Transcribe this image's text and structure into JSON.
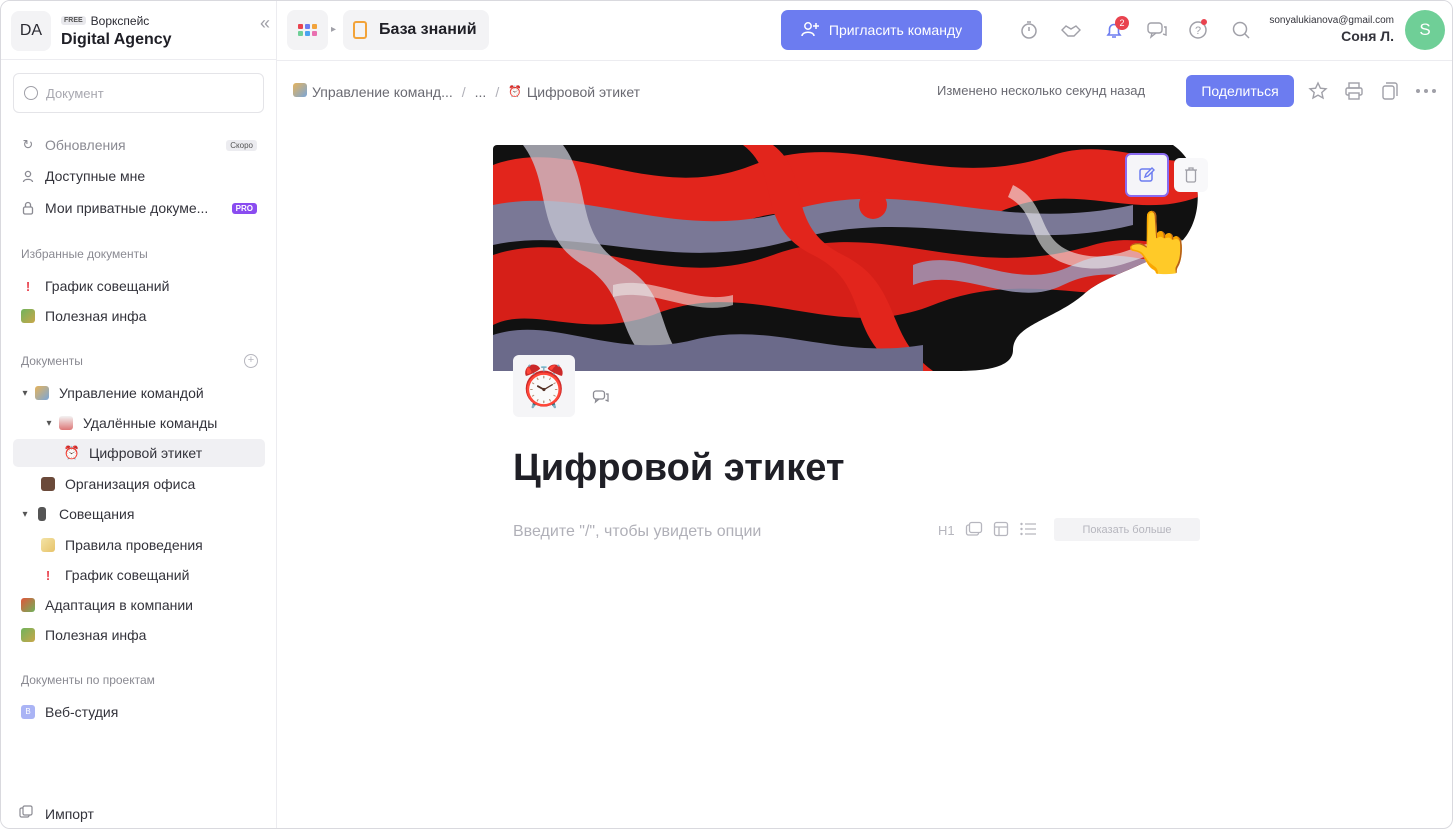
{
  "workspace": {
    "initials": "DA",
    "plan_badge": "FREE",
    "label": "Воркспейс",
    "name": "Digital Agency"
  },
  "search": {
    "placeholder": "Документ"
  },
  "nav": {
    "updates": {
      "label": "Обновления",
      "badge": "Скоро"
    },
    "shared": {
      "label": "Доступные мне"
    },
    "private": {
      "label": "Мои приватные докуме...",
      "badge": "PRO"
    }
  },
  "favorites": {
    "title": "Избранные документы",
    "items": [
      {
        "label": "График совещаний"
      },
      {
        "label": "Полезная инфа"
      }
    ]
  },
  "documents": {
    "title": "Документы",
    "tree": [
      {
        "label": "Управление командой"
      },
      {
        "label": "Удалённые команды"
      },
      {
        "label": "Цифровой этикет"
      },
      {
        "label": "Организация офиса"
      },
      {
        "label": "Совещания"
      },
      {
        "label": "Правила проведения"
      },
      {
        "label": "График совещаний"
      },
      {
        "label": "Адаптация в компании"
      },
      {
        "label": "Полезная инфа"
      }
    ]
  },
  "projects": {
    "title": "Документы по проектам",
    "items": [
      {
        "label": "Веб-студия",
        "initial": "В"
      }
    ]
  },
  "import_label": "Импорт",
  "topbar": {
    "section_title": "База знаний",
    "invite_label": "Пригласить команду",
    "notification_count": "2",
    "user_email": "sonyalukianova@gmail.com",
    "user_name": "Соня Л.",
    "user_initial": "S"
  },
  "breadcrumb": {
    "root": "Управление команд...",
    "middle": "...",
    "current": "Цифровой этикет"
  },
  "doc_header": {
    "modified": "Изменено несколько секунд назад",
    "share_label": "Поделиться"
  },
  "document": {
    "title": "Цифровой этикет",
    "placeholder": "Введите \"/\", чтобы увидеть опции",
    "h1_label": "H1",
    "show_more": "Показать больше"
  },
  "colors": {
    "accent": "#6c7cf0",
    "pro": "#8a4cf0",
    "alert": "#e9434f",
    "avatar": "#6fcf97"
  }
}
